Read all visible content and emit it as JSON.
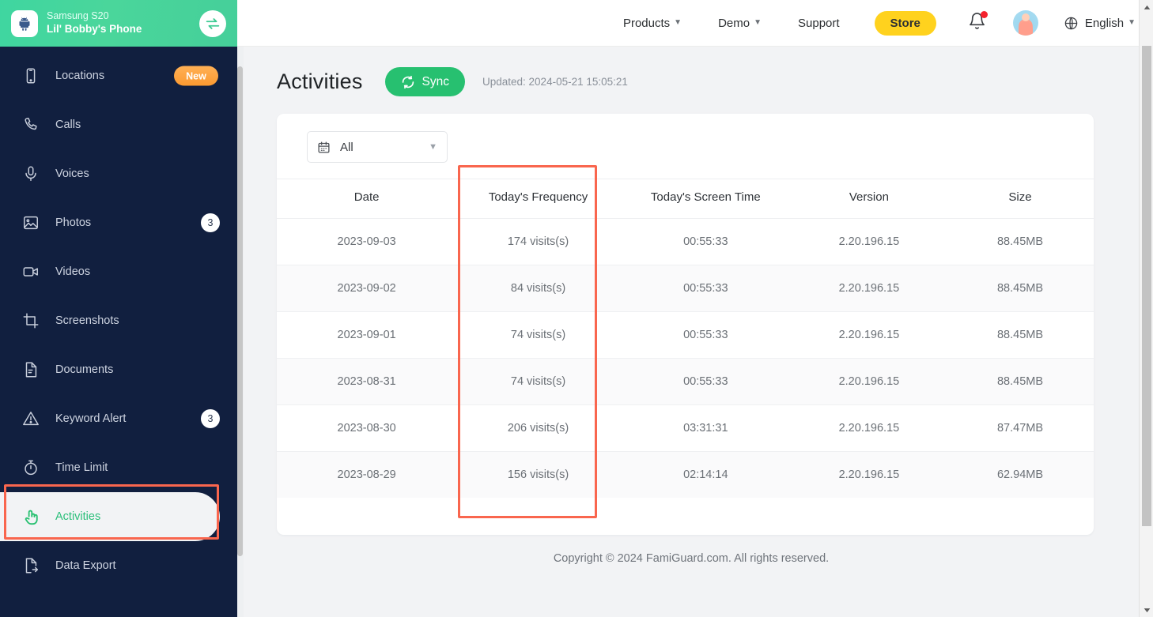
{
  "sidebar": {
    "device_model": "Samsung S20",
    "device_name": "Lil' Bobby's Phone",
    "logo_icon": "android-robot-icon",
    "switch_icon": "switch-device-icon",
    "items": [
      {
        "label": "Locations",
        "icon": "phone-location-icon",
        "badge": "New",
        "badge_type": "new",
        "active": false
      },
      {
        "label": "Calls",
        "icon": "phone-call-icon",
        "badge": "",
        "badge_type": "",
        "active": false
      },
      {
        "label": "Voices",
        "icon": "microphone-icon",
        "badge": "",
        "badge_type": "",
        "active": false
      },
      {
        "label": "Photos",
        "icon": "photo-icon",
        "badge": "3",
        "badge_type": "count",
        "active": false
      },
      {
        "label": "Videos",
        "icon": "video-camera-icon",
        "badge": "",
        "badge_type": "",
        "active": false
      },
      {
        "label": "Screenshots",
        "icon": "crop-icon",
        "badge": "",
        "badge_type": "",
        "active": false
      },
      {
        "label": "Documents",
        "icon": "document-icon",
        "badge": "",
        "badge_type": "",
        "active": false
      },
      {
        "label": "Keyword Alert",
        "icon": "warning-triangle-icon",
        "badge": "3",
        "badge_type": "count",
        "active": false
      },
      {
        "label": "Time Limit",
        "icon": "stopwatch-icon",
        "badge": "",
        "badge_type": "",
        "active": false
      },
      {
        "label": "Activities",
        "icon": "hand-tap-icon",
        "badge": "",
        "badge_type": "",
        "active": true
      },
      {
        "label": "Data Export",
        "icon": "export-file-icon",
        "badge": "",
        "badge_type": "",
        "active": false
      }
    ]
  },
  "topnav": {
    "products": "Products",
    "demo": "Demo",
    "support": "Support",
    "store": "Store",
    "bell_icon": "notification-bell-icon",
    "avatar_icon": "user-avatar",
    "globe_icon": "globe-icon",
    "language": "English"
  },
  "page": {
    "title": "Activities",
    "sync_label": "Sync",
    "sync_icon": "refresh-icon",
    "updated": "Updated: 2024-05-21 15:05:21"
  },
  "filter": {
    "icon": "calendar-icon",
    "value": "All",
    "chevron": "chevron-down-icon"
  },
  "table": {
    "headers": [
      "Date",
      "Today's Frequency",
      "Today's Screen Time",
      "Version",
      "Size"
    ],
    "rows": [
      [
        "2023-09-03",
        "174 visits(s)",
        "00:55:33",
        "2.20.196.15",
        "88.45MB"
      ],
      [
        "2023-09-02",
        "84 visits(s)",
        "00:55:33",
        "2.20.196.15",
        "88.45MB"
      ],
      [
        "2023-09-01",
        "74 visits(s)",
        "00:55:33",
        "2.20.196.15",
        "88.45MB"
      ],
      [
        "2023-08-31",
        "74 visits(s)",
        "00:55:33",
        "2.20.196.15",
        "88.45MB"
      ],
      [
        "2023-08-30",
        "206 visits(s)",
        "03:31:31",
        "2.20.196.15",
        "87.47MB"
      ],
      [
        "2023-08-29",
        "156 visits(s)",
        "02:14:14",
        "2.20.196.15",
        "62.94MB"
      ]
    ]
  },
  "footer": {
    "copyright": "Copyright © 2024 FamiGuard.com. All rights reserved."
  },
  "colors": {
    "sidebar_bg": "#111f3f",
    "header_green": "#45cf9a",
    "accent_green": "#27c070",
    "store_yellow": "#ffd21e",
    "badge_orange": "#fb9a31",
    "annotation_red": "#f9664e"
  }
}
